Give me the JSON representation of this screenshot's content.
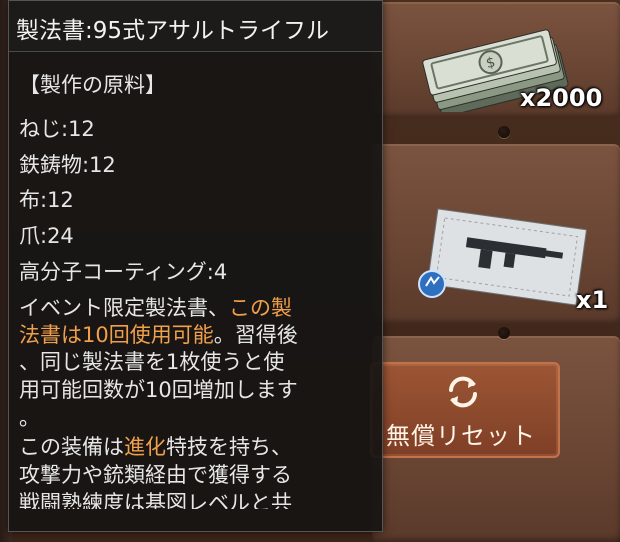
{
  "tooltip": {
    "title": "製法書:95式アサルトライフル",
    "section_heading": "【製作の原料】",
    "materials": [
      "ねじ:12",
      "鉄鋳物:12",
      "布:12",
      "爪:24",
      "高分子コーティング:4"
    ],
    "desc": {
      "l1a": "イベント限定製法書、",
      "l1b": "この製",
      "l2a": "法書は10回使用可能",
      "l2b": "。習得後",
      "l3": "、同じ製法書を1枚使うと使",
      "l4": "用可能回数が10回増加します",
      "l5": "。",
      "l6a": "この装備は",
      "l6b": "進化",
      "l6c": "特技を持ち、",
      "l7": "攻撃力や銃類経由で獲得する",
      "l8": "戦闘熟練度は基図レベルと共"
    }
  },
  "rewards": [
    {
      "icon": "cash-stack-icon",
      "quantity": "x2000"
    },
    {
      "icon": "blueprint-icon",
      "quantity": "x1"
    }
  ],
  "reset_button": {
    "label": "無償リセット",
    "icon": "refresh-icon"
  },
  "colors": {
    "highlight": "#f0a04a",
    "panel": "#151413",
    "button": "#9c5635"
  }
}
